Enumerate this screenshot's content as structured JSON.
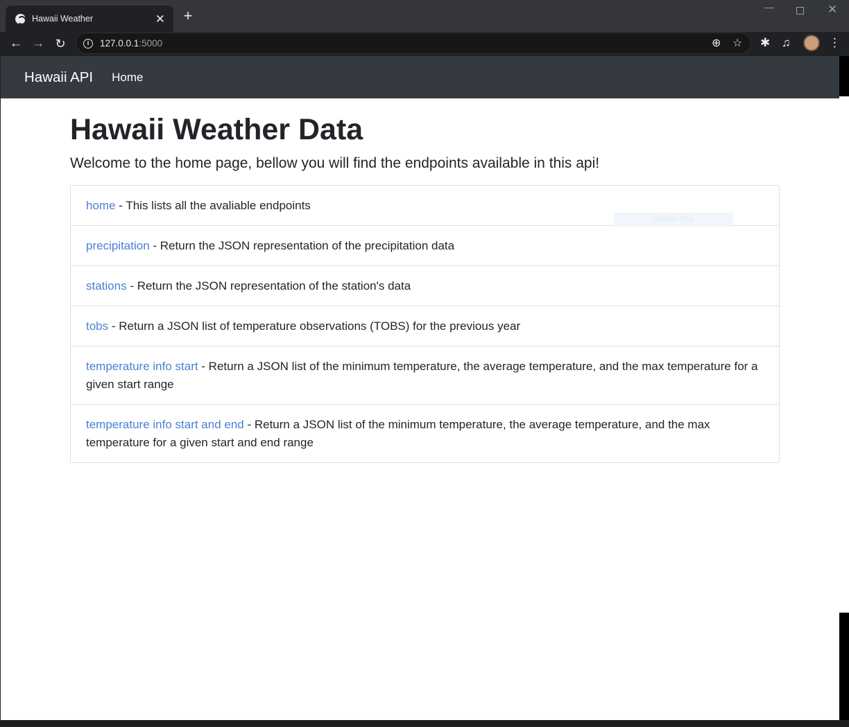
{
  "browser": {
    "tab_title": "Hawaii Weather",
    "tab_close": "✕",
    "new_tab": "+",
    "url_host": "127.0.0.1",
    "url_port": ":5000"
  },
  "navbar": {
    "brand": "Hawaii API",
    "home_link": "Home"
  },
  "main": {
    "title": "Hawaii Weather Data",
    "lead": "Welcome to the home page, bellow you will find the endpoints available in this api!",
    "endpoints": [
      {
        "link": "home",
        "desc": " - This lists all the avaliable endpoints"
      },
      {
        "link": "precipitation",
        "desc": " - Return the JSON representation of the precipitation data"
      },
      {
        "link": "stations",
        "desc": " - Return the JSON representation of the station's data"
      },
      {
        "link": "tobs",
        "desc": " - Return a JSON list of temperature observations (TOBS) for the previous year"
      },
      {
        "link": "temperature info start",
        "desc": " - Return a JSON list of the minimum temperature, the average temperature, and the max temperature for a given start range"
      },
      {
        "link": "temperature info start and end",
        "desc": " - Return a JSON list of the minimum temperature, the average temperature, and the max temperature for a given start and end range"
      }
    ]
  },
  "overlay": {
    "snip_hint": "Window Snip"
  },
  "colors": {
    "navbar_bg": "#343a40",
    "link": "#4a80d4",
    "chrome_bg": "#202124"
  }
}
